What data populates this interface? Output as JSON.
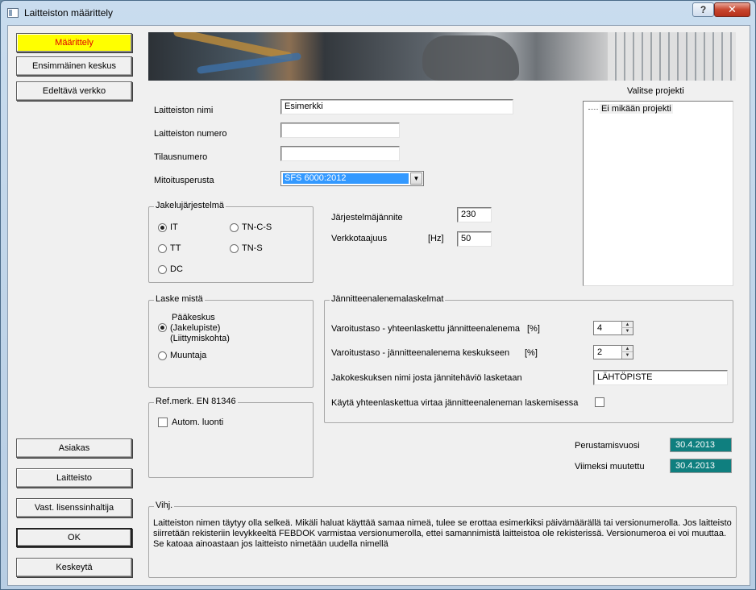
{
  "window": {
    "title": "Laitteiston määrittely",
    "help_label": "?",
    "close_label": "✕"
  },
  "left_nav": {
    "maarittely": "Määrittely",
    "ensimmainen_keskus": "Ensimmäinen keskus",
    "edeltava_verkko": "Edeltävä verkko",
    "asiakas": "Asiakas",
    "laitteisto": "Laitteisto",
    "vast_lisenssinhaltija": "Vast. lisenssinhaltija",
    "ok": "OK",
    "keskeyta": "Keskeytä"
  },
  "form": {
    "nimi_label": "Laitteiston nimi",
    "nimi_value": "Esimerkki",
    "numero_label": "Laitteiston numero",
    "numero_value": "",
    "tilausnumero_label": "Tilausnumero",
    "tilausnumero_value": "",
    "mitoitusperusta_label": "Mitoitusperusta",
    "mitoitusperusta_value": "SFS 6000:2012"
  },
  "projects": {
    "label": "Valitse projekti",
    "items": [
      "Ei mikään projekti"
    ]
  },
  "jakelujarjestelma": {
    "legend": "Jakelujärjestelmä",
    "options": [
      {
        "label": "IT",
        "checked": true
      },
      {
        "label": "TN-C-S",
        "checked": false
      },
      {
        "label": "TT",
        "checked": false
      },
      {
        "label": "TN-S",
        "checked": false
      },
      {
        "label": "DC",
        "checked": false
      }
    ]
  },
  "system": {
    "jannite_label": "Järjestelmäjännite",
    "jannite_value": "230",
    "taajuus_label": "Verkkotaajuus",
    "taajuus_unit": "[Hz]",
    "taajuus_value": "50"
  },
  "laske_mista": {
    "legend": "Laske mistä",
    "paakeskus_lines": [
      "Pääkeskus",
      "(Jakelupiste)",
      "(Liittymiskohta)"
    ],
    "muuntaja": "Muuntaja",
    "selected": "paakeskus"
  },
  "ref_merk": {
    "legend": "Ref.merk. EN 81346",
    "autom_luonti": "Autom. luonti",
    "checked": false
  },
  "voltage_drop": {
    "legend": "Jännitteenalenemalaskelmat",
    "varoitus_yhteen_label": "Varoitustaso - yhteenlaskettu jännitteenalenema",
    "varoitus_yhteen_unit": "[%]",
    "varoitus_yhteen_value": "4",
    "varoitus_keskus_label": "Varoitustaso - jännitteenalenema keskukseen",
    "varoitus_keskus_unit": "[%]",
    "varoitus_keskus_value": "2",
    "jakokeskus_label": "Jakokeskuksen nimi josta jännitehäviö lasketaan",
    "jakokeskus_value": "LÄHTÖPISTE",
    "kayta_label": "Käytä yhteenlaskettua virtaa jännitteenaleneman laskemisessa",
    "kayta_checked": false
  },
  "dates": {
    "perustamisvuosi_label": "Perustamisvuosi",
    "perustamisvuosi_value": "30.4.2013",
    "muutettu_label": "Viimeksi muutettu",
    "muutettu_value": "30.4.2013"
  },
  "hint": {
    "legend": "Vihj.",
    "text": "Laitteiston nimen täytyy olla selkeä. Mikäli haluat käyttää samaa nimeä, tulee se erottaa esimerkiksi päivämäärällä tai versionumerolla. Jos laitteisto siirretään rekisteriin levykkeeltä FEBDOK varmistaa versionumerolla, ettei samannimistä laitteistoa ole rekisterissä. Versionumeroa ei voi muuttaa. Se katoaa ainoastaan jos laitteisto nimetään uudella nimellä"
  },
  "colors": {
    "active_button_bg": "#ffff00",
    "active_button_text": "#e00000",
    "date_bg": "#0f7f7f",
    "selection": "#3399ff"
  }
}
